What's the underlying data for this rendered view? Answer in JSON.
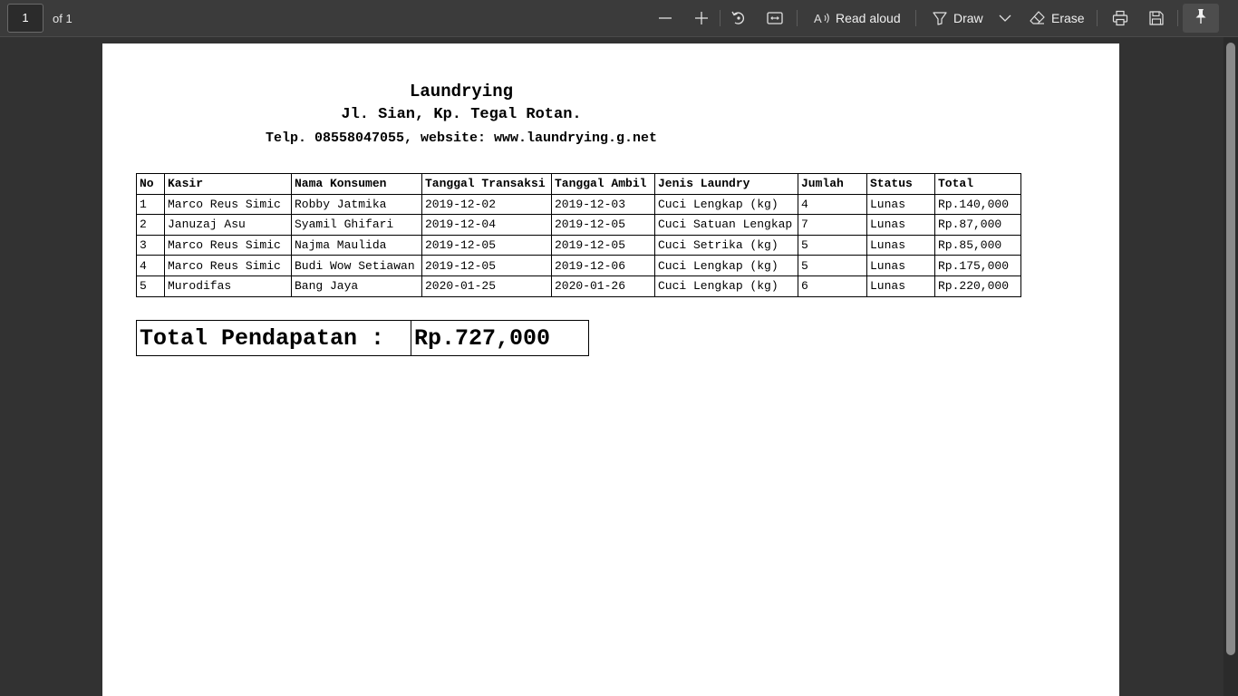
{
  "toolbar": {
    "page_number": "1",
    "page_of": "of 1",
    "read_aloud": "Read aloud",
    "draw": "Draw",
    "erase": "Erase"
  },
  "document": {
    "title": "Laundrying",
    "address": "Jl. Sian, Kp. Tegal Rotan.",
    "contact": "Telp. 08558047055, website: www.laundrying.g.net",
    "table": {
      "headers": [
        "No",
        "Kasir",
        "Nama Konsumen",
        "Tanggal Transaksi",
        "Tanggal Ambil",
        "Jenis Laundry",
        "Jumlah",
        "Status",
        "Total"
      ],
      "rows": [
        [
          "1",
          "Marco Reus Simic",
          "Robby Jatmika",
          "2019-12-02",
          "2019-12-03",
          "Cuci Lengkap (kg)",
          "4",
          "Lunas",
          "Rp.140,000"
        ],
        [
          "2",
          "Januzaj Asu",
          "Syamil Ghifari",
          "2019-12-04",
          "2019-12-05",
          "Cuci Satuan Lengkap",
          "7",
          "Lunas",
          "Rp.87,000"
        ],
        [
          "3",
          "Marco Reus Simic",
          "Najma Maulida",
          "2019-12-05",
          "2019-12-05",
          "Cuci Setrika (kg)",
          "5",
          "Lunas",
          "Rp.85,000"
        ],
        [
          "4",
          "Marco Reus Simic",
          "Budi Wow Setiawan",
          "2019-12-05",
          "2019-12-06",
          "Cuci Lengkap (kg)",
          "5",
          "Lunas",
          "Rp.175,000"
        ],
        [
          "5",
          "Murodifas",
          "Bang Jaya",
          "2020-01-25",
          "2020-01-26",
          "Cuci Lengkap (kg)",
          "6",
          "Lunas",
          "Rp.220,000"
        ]
      ]
    },
    "total_label": "Total Pendapatan :",
    "total_value": "Rp.727,000"
  }
}
